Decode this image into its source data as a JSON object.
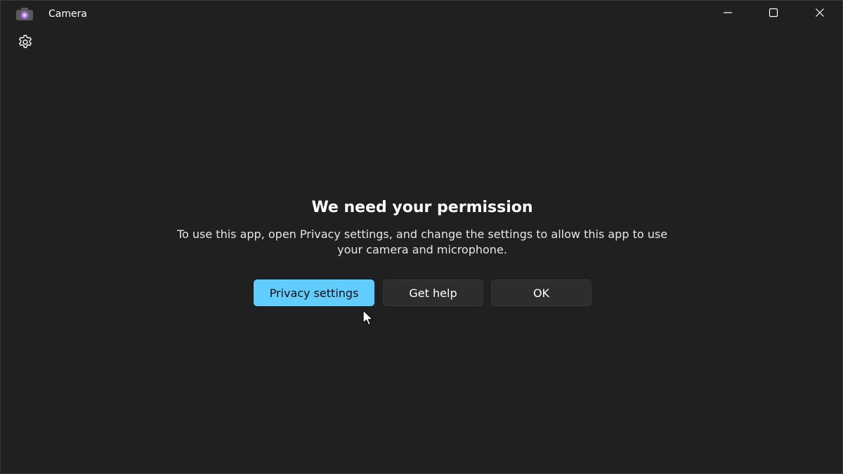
{
  "window": {
    "title": "Camera",
    "icons": {
      "app": "camera-icon",
      "minimize": "minimize-icon",
      "maximize": "maximize-icon",
      "close": "close-icon",
      "settings": "gear-icon"
    }
  },
  "dialog": {
    "heading": "We need your permission",
    "message": "To use this app, open Privacy settings, and change the settings to allow this app to use your camera and microphone.",
    "buttons": {
      "privacy": "Privacy settings",
      "help": "Get help",
      "ok": "OK"
    }
  },
  "colors": {
    "background": "#202020",
    "accent": "#60cdff",
    "secondary_button": "#2d2d2d"
  }
}
